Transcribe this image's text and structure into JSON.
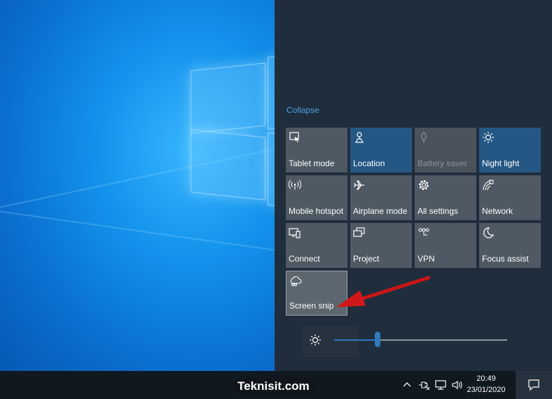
{
  "action_center": {
    "collapse_label": "Collapse",
    "tiles": [
      {
        "label": "Tablet mode",
        "icon": "tablet-mode-icon",
        "state": "off"
      },
      {
        "label": "Location",
        "icon": "location-icon",
        "state": "on"
      },
      {
        "label": "Battery saver",
        "icon": "battery-saver-icon",
        "state": "disabled"
      },
      {
        "label": "Night light",
        "icon": "night-light-icon",
        "state": "on"
      },
      {
        "label": "Mobile hotspot",
        "icon": "mobile-hotspot-icon",
        "state": "off"
      },
      {
        "label": "Airplane mode",
        "icon": "airplane-icon",
        "state": "off"
      },
      {
        "label": "All settings",
        "icon": "gear-icon",
        "state": "off"
      },
      {
        "label": "Network",
        "icon": "network-icon",
        "state": "off"
      },
      {
        "label": "Connect",
        "icon": "connect-icon",
        "state": "off"
      },
      {
        "label": "Project",
        "icon": "project-icon",
        "state": "off"
      },
      {
        "label": "VPN",
        "icon": "vpn-icon",
        "state": "off"
      },
      {
        "label": "Focus assist",
        "icon": "moon-icon",
        "state": "off"
      },
      {
        "label": "Screen snip",
        "icon": "screen-snip-icon",
        "state": "highlighted"
      }
    ],
    "brightness": {
      "icon": "sun-icon",
      "level": 0.25
    }
  },
  "taskbar": {
    "tray_icons": [
      "chevron-up-icon",
      "power-plug-icon",
      "network-monitor-icon",
      "volume-icon"
    ],
    "time": "20:49",
    "date": "23/01/2020",
    "notification_icon": "notification-icon"
  },
  "watermark": "Teknisit.com",
  "colors": {
    "panel_bg": "#1f2d3c",
    "tile_off": "#4e5963",
    "tile_on": "#255784",
    "accent": "#4ea2e6",
    "taskbar": "#101820",
    "arrow": "#d01818"
  }
}
